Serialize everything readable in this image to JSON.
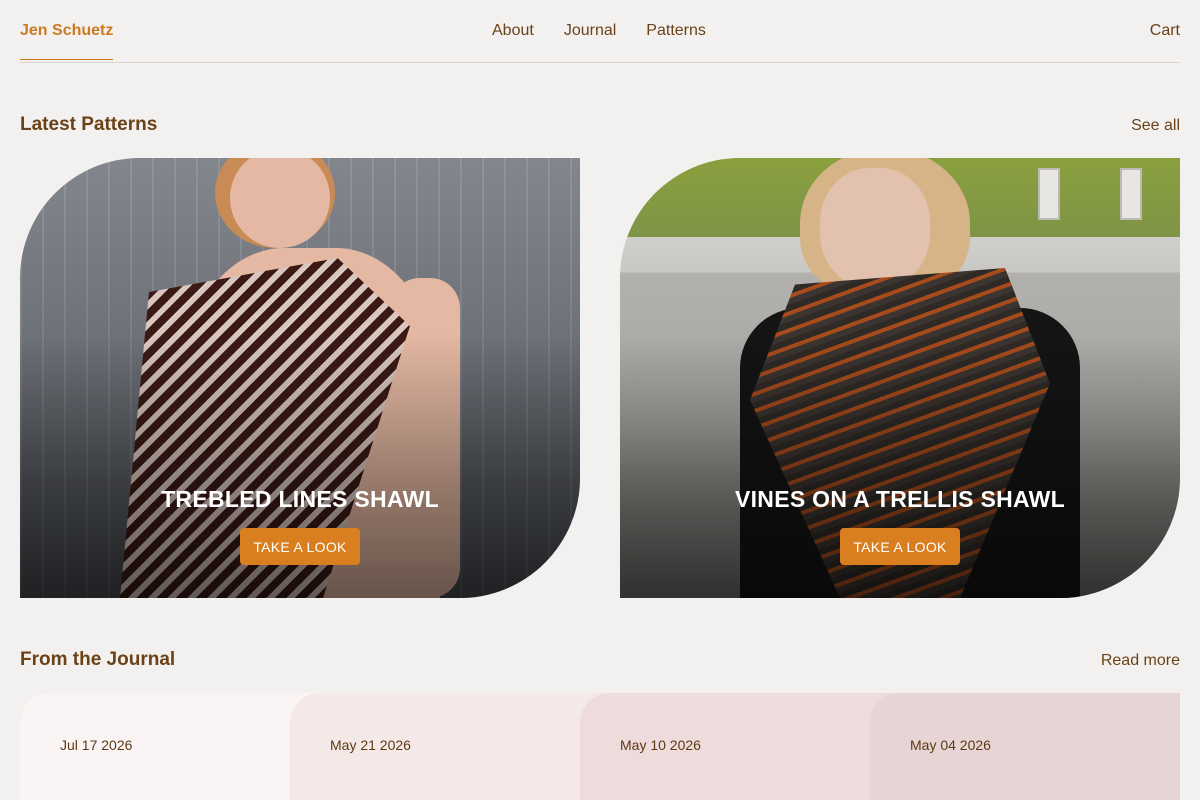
{
  "header": {
    "brand": "Jen Schuetz",
    "nav": [
      "About",
      "Journal",
      "Patterns"
    ],
    "cart": "Cart"
  },
  "latest": {
    "title": "Latest Patterns",
    "link": "See all",
    "cards": [
      {
        "title": "TREBLED LINES SHAWL",
        "button": "TAKE A LOOK"
      },
      {
        "title": "VINES ON A TRELLIS SHAWL",
        "button": "TAKE A LOOK"
      }
    ]
  },
  "journal": {
    "title": "From the Journal",
    "link": "Read more",
    "entries": [
      {
        "date": "Jul 17 2026"
      },
      {
        "date": "May 21 2026"
      },
      {
        "date": "May 10 2026"
      },
      {
        "date": "May 04 2026"
      }
    ]
  },
  "colors": {
    "accent": "#d97f1f",
    "text": "#6b4218",
    "background": "#f3f1ef"
  }
}
